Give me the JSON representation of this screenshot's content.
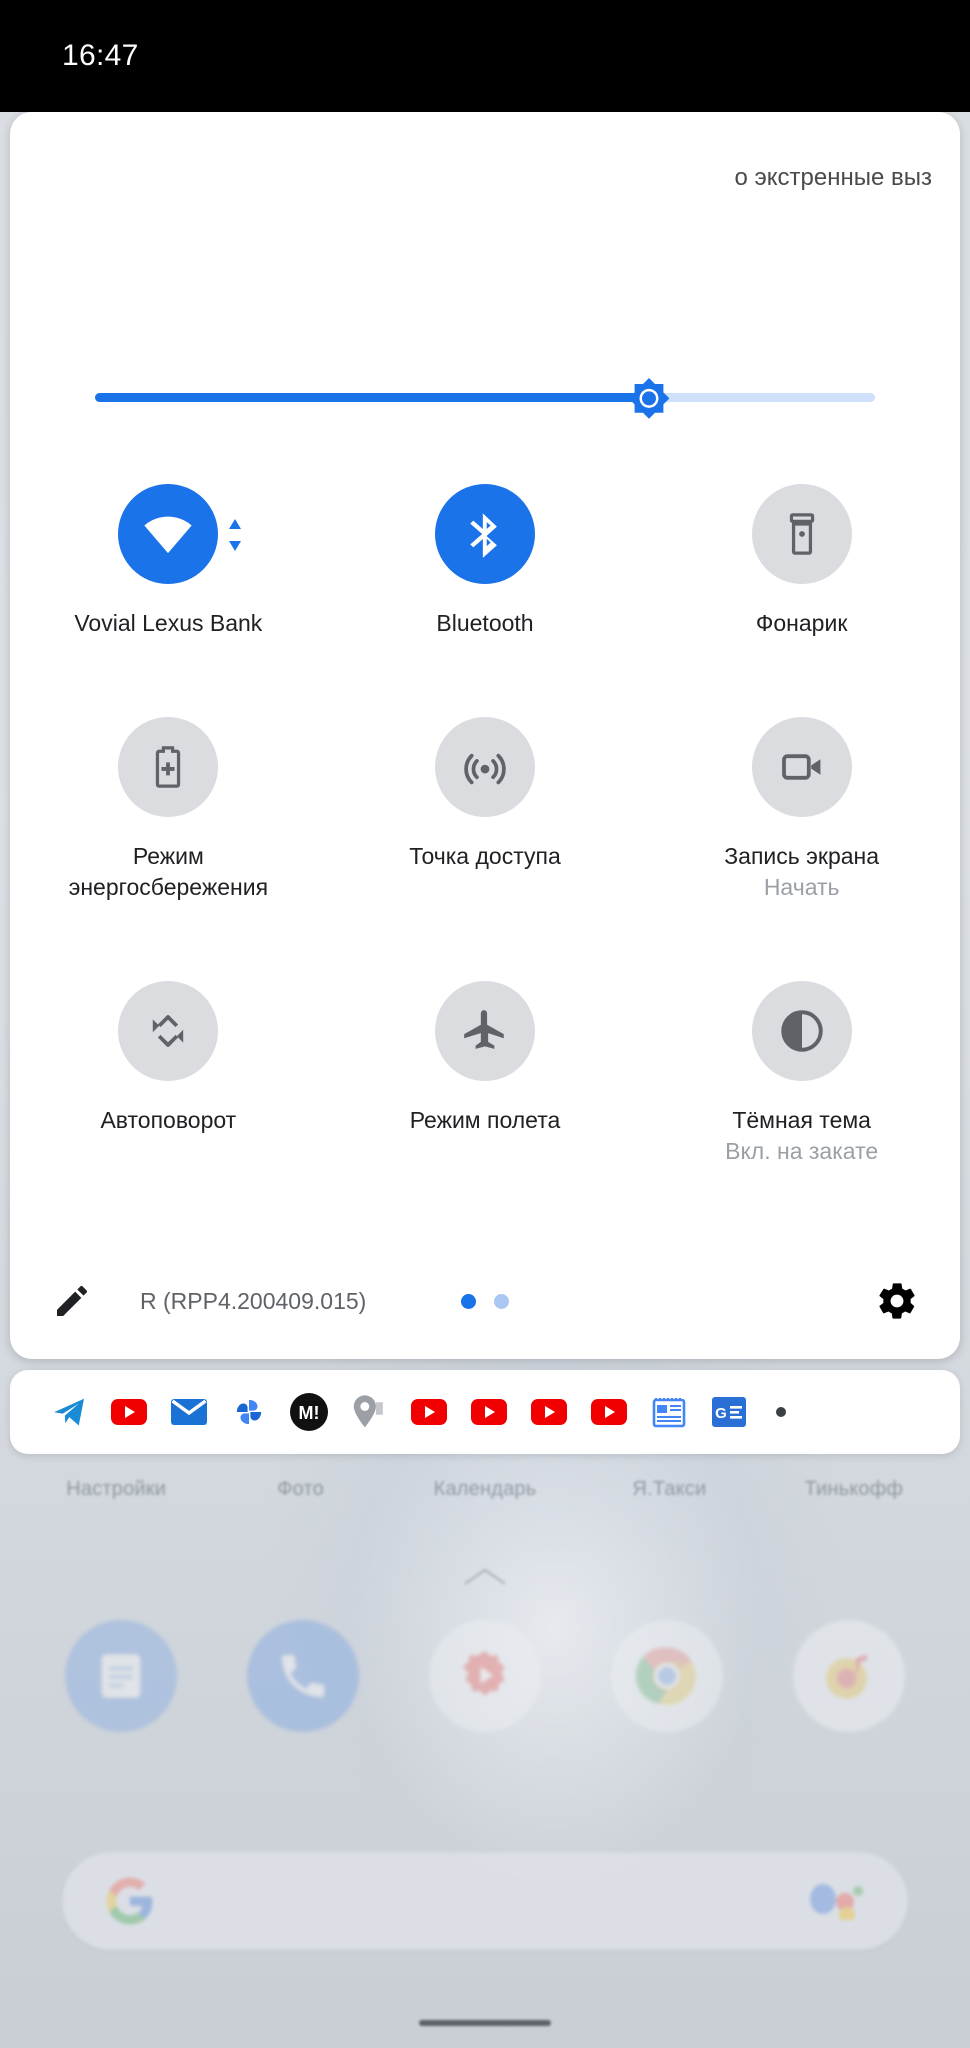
{
  "statusbar": {
    "clock": "16:47"
  },
  "quick_settings": {
    "carrier_text": "о экстренные выз",
    "brightness": {
      "value_pct": 71,
      "icon": "brightness-icon"
    },
    "tiles": [
      {
        "label": "Vovial Lexus Bank",
        "sub": "",
        "icon": "wifi-icon",
        "state": "on"
      },
      {
        "label": "Bluetooth",
        "sub": "",
        "icon": "bluetooth-icon",
        "state": "on"
      },
      {
        "label": "Фонарик",
        "sub": "",
        "icon": "flashlight-icon",
        "state": "off"
      },
      {
        "label": "Режим энергосбережения",
        "sub": "",
        "icon": "battery-saver-icon",
        "state": "off"
      },
      {
        "label": "Точка доступа",
        "sub": "",
        "icon": "hotspot-icon",
        "state": "off"
      },
      {
        "label": "Запись экрана",
        "sub": "Начать",
        "icon": "screen-record-icon",
        "state": "off"
      },
      {
        "label": "Автоповорот",
        "sub": "",
        "icon": "auto-rotate-icon",
        "state": "off"
      },
      {
        "label": "Режим полета",
        "sub": "",
        "icon": "airplane-icon",
        "state": "off"
      },
      {
        "label": "Тёмная тема",
        "sub": "Вкл. на закате",
        "icon": "dark-theme-icon",
        "state": "off"
      }
    ],
    "footer": {
      "edit_icon": "pencil-icon",
      "build": "R (RPP4.200409.015)",
      "pages": 2,
      "active_page": 1,
      "settings_icon": "gear-icon"
    }
  },
  "notifications": {
    "icons": [
      "telegram-icon",
      "youtube-icon",
      "mail-icon",
      "photos-icon",
      "m-exclaim-icon",
      "maps-pin-icon",
      "youtube-icon",
      "youtube-icon",
      "youtube-icon",
      "youtube-icon",
      "news-paper-icon",
      "google-news-icon"
    ],
    "overflow": "overflow-dot"
  },
  "home": {
    "app_labels": [
      "Настройки",
      "Фото",
      "Календарь",
      "Я.Такси",
      "Тинькофф"
    ],
    "dock": [
      "messages-icon",
      "phone-icon",
      "play-store-icon",
      "chrome-icon",
      "yt-music-icon"
    ],
    "search": {
      "logo": "google-g-icon",
      "assistant": "assistant-mic-icon"
    },
    "pull_handle": "chevron-up-icon",
    "nav_pill": "home-gesture-pill"
  },
  "colors": {
    "accent": "#1a73e8",
    "tile_off": "#dadce0",
    "panel": "#ffffff",
    "text": "#202124",
    "text_muted": "#9aa0a6"
  }
}
